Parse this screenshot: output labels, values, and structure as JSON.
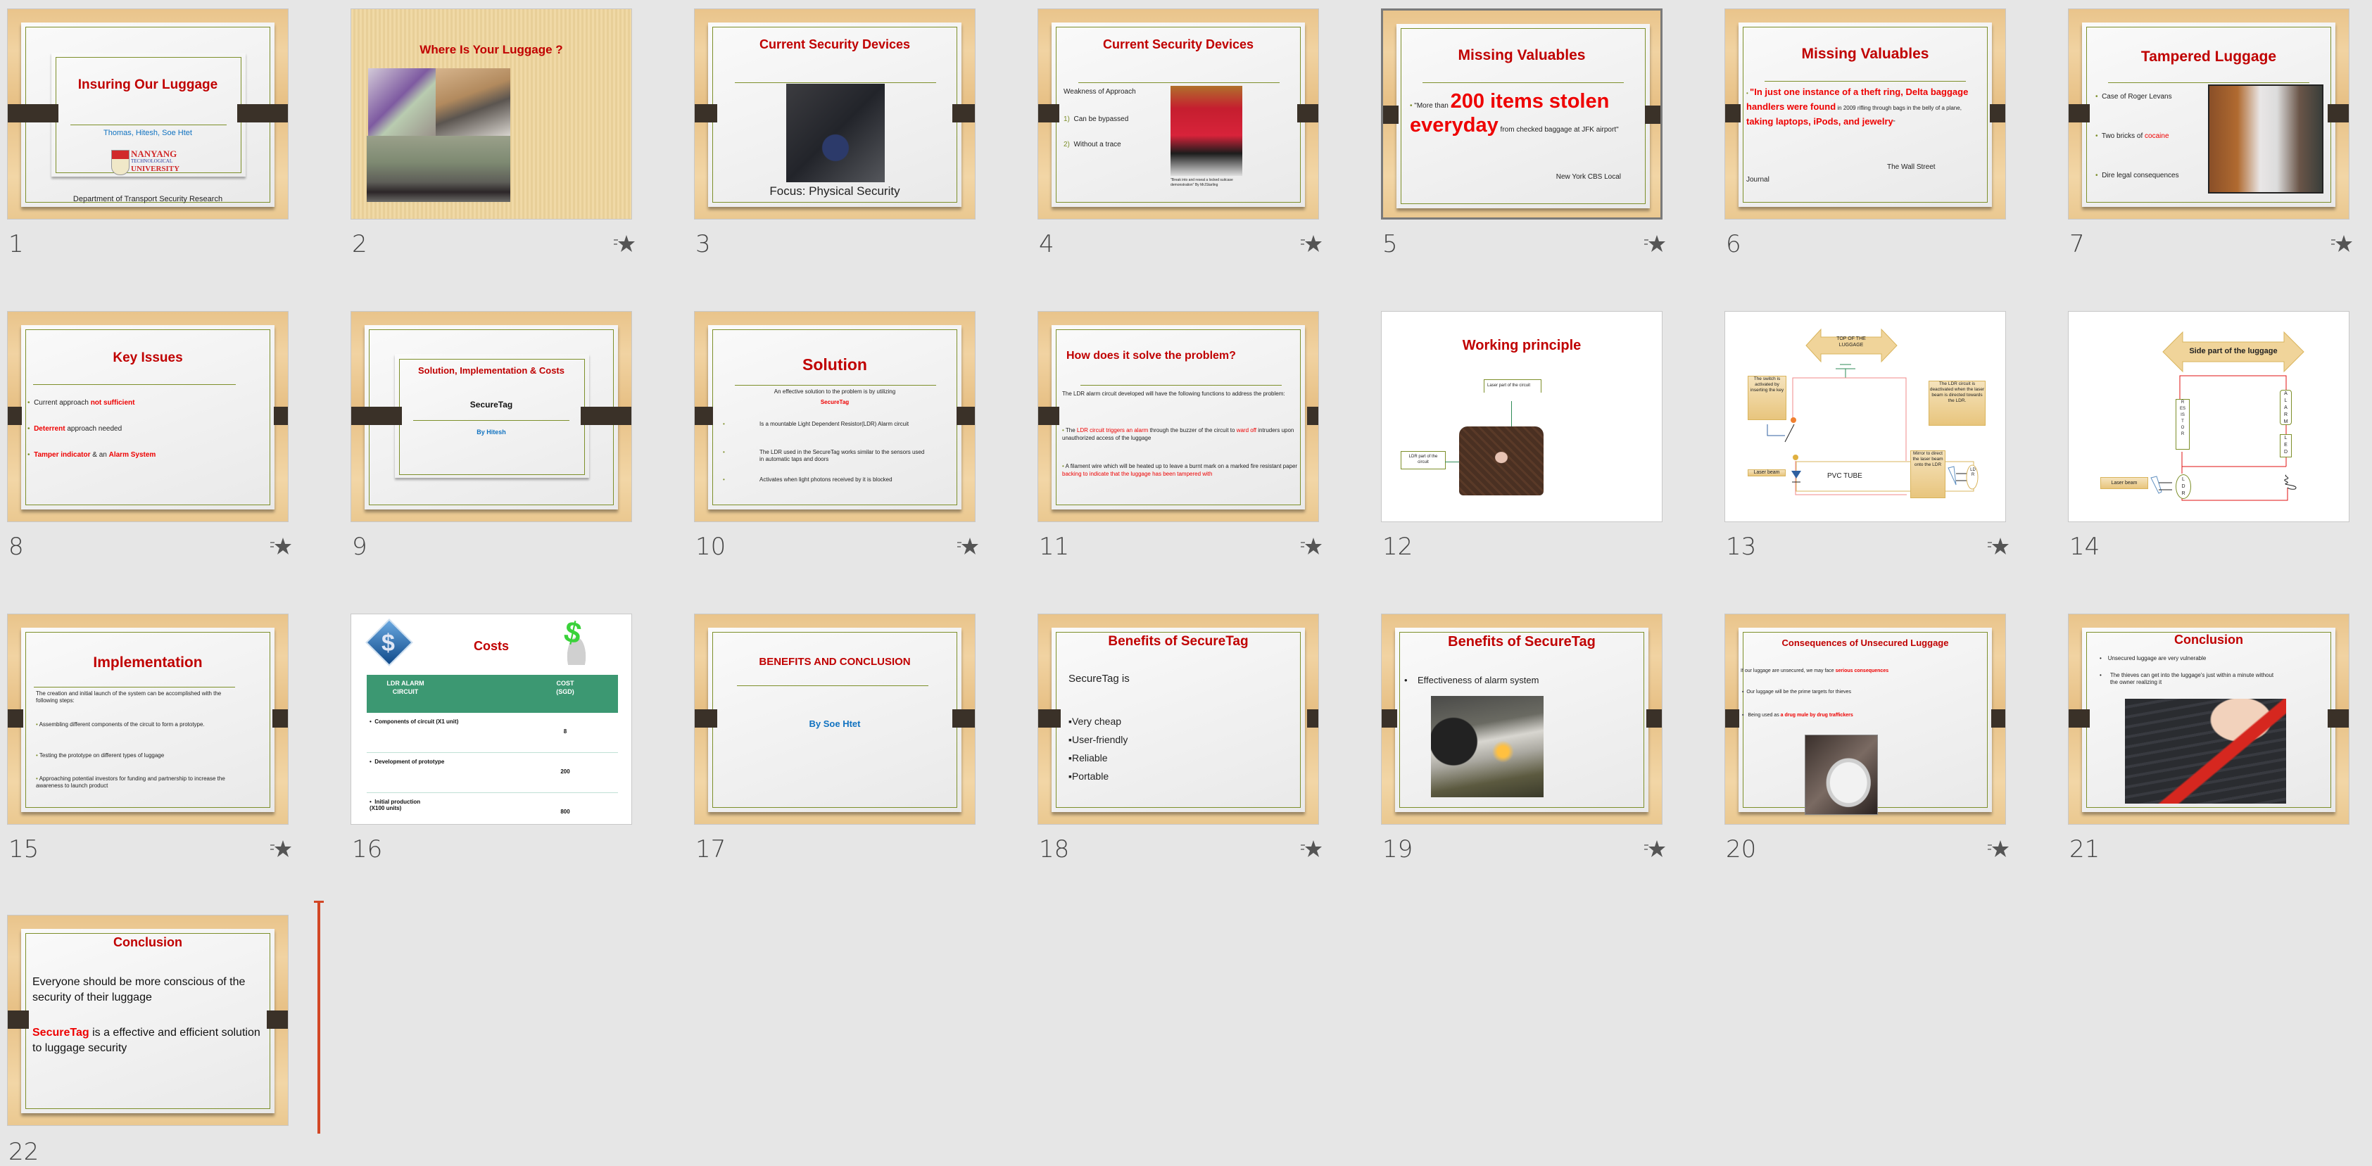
{
  "view": "Slide Sorter",
  "selected_slide": 5,
  "colors": {
    "title_red": "#c00000",
    "accent_red": "#e00000",
    "blue": "#1072c0",
    "olive_rule": "#7d8f2a",
    "insert_cursor": "#d24726",
    "background": "#e6e6e6"
  },
  "slides": [
    {
      "number": "1",
      "has_animation": false,
      "title": "Insuring Our Luggage",
      "authors": "Thomas, Hitesh, Soe Htet",
      "logo": {
        "line1": "NANYANG",
        "line2": "TECHNOLOGICAL",
        "line3": "UNIVERSITY"
      },
      "footer": "Department of Transport Security Research"
    },
    {
      "number": "2",
      "has_animation": true,
      "title": "Where Is Your Luggage ?"
    },
    {
      "number": "3",
      "has_animation": false,
      "title": "Current Security Devices",
      "caption": "Focus: Physical Security"
    },
    {
      "number": "4",
      "has_animation": true,
      "title": "Current Security Devices",
      "intro": "Weakness of Approach",
      "items": [
        "Can be bypassed",
        "Without a trace"
      ],
      "item_markers": [
        "1)",
        "2)"
      ],
      "credit": "\"Break into and reseal a locked suitcase demonstration\" By MrJStarling"
    },
    {
      "number": "5",
      "has_animation": true,
      "title": "Missing Valuables",
      "quote_pre": "\"More than ",
      "quote_big": "200 items stolen everyday",
      "quote_mid": " from checked baggage at JFK airport\"",
      "source": "New York CBS Local"
    },
    {
      "number": "6",
      "has_animation": false,
      "title": "Missing Valuables",
      "q1": "\"In just one instance of a theft ring, Delta baggage handlers were found",
      "q2": " in 2009 rifling through bags in the belly of a plane, ",
      "q3": "taking laptops, iPods, and jewelry",
      "q4": "\"",
      "source1": "The Wall Street",
      "source2": "Journal"
    },
    {
      "number": "7",
      "has_animation": true,
      "title": "Tampered Luggage",
      "b1": "Case of Roger Levans",
      "b2_pre": "Two bricks of ",
      "b2_red": "cocaine",
      "b3": "Dire legal consequences"
    },
    {
      "number": "8",
      "has_animation": true,
      "title": "Key Issues",
      "b1_pre": "Current approach ",
      "b1_red": "not sufficient",
      "b2_red": "Deterrent",
      "b2_post": " approach needed",
      "b3_red1": "Tamper indicator",
      "b3_mid": " & an ",
      "b3_red2": "Alarm System"
    },
    {
      "number": "9",
      "has_animation": false,
      "title": "Solution, Implementation & Costs",
      "subtitle": "SecureTag",
      "by": "By Hitesh"
    },
    {
      "number": "10",
      "has_animation": true,
      "title": "Solution",
      "intro": "An effective solution to the problem is by utilizing",
      "highlight": "SecureTag",
      "bullets": [
        "Is a mountable Light Dependent Resistor(LDR) Alarm circuit",
        "The LDR used in the SecureTag works similar to the sensors used in automatic taps and doors",
        "Activates when light photons received by it is blocked"
      ]
    },
    {
      "number": "11",
      "has_animation": true,
      "title": "How does it solve the problem?",
      "intro": "The LDR alarm circuit developed will have the following functions to address the problem:",
      "b1a": "The ",
      "b1b": "LDR circuit triggers an alarm",
      "b1c": " through the buzzer of the circuit to ",
      "b1d": "ward off",
      "b1e": " intruders upon unauthorized access of the luggage",
      "b2a": "A filament wire which will be heated up to leave a burnt mark on a marked fire resistant paper ",
      "b2b": "backing to indicate that the luggage has been tampered with"
    },
    {
      "number": "12",
      "has_animation": false,
      "title": "Working principle",
      "label_top": "Laser part of the circuit",
      "label_left": "LDR part of the circuit"
    },
    {
      "number": "13",
      "has_animation": true,
      "arrow_label": "TOP OF THE LUGGAGE",
      "switch_note": "The switch is activated by inserting the key",
      "ldr_note": "The LDR circuit is deactivated when the  laser beam is directed towards the LDR.",
      "laser_label": "Laser beam",
      "tube_label": "PVC TUBE",
      "mirror_note": "Mirror to direct the laser beam onto the LDR",
      "ldr_label": "LDR"
    },
    {
      "number": "14",
      "has_animation": false,
      "arrow_label": "Side part of the luggage",
      "resistor": "RESISTOR",
      "alarm": "ALARM",
      "led": "LED",
      "ldr": "LDR",
      "laser_label": "Laser beam"
    },
    {
      "number": "15",
      "has_animation": true,
      "title": "Implementation",
      "intro": "The creation and initial launch of the system can be accomplished with the following steps:",
      "bullets": [
        "Assembling different components of the circuit to form a prototype.",
        "Testing the prototype on different types of luggage",
        "Approaching potential investors for funding and partnership to increase the awareness to launch product"
      ]
    },
    {
      "number": "16",
      "has_animation": false,
      "title": "Costs",
      "table": {
        "headers": [
          "LDR ALARM CIRCUIT",
          "COST (SGD)"
        ],
        "rows": [
          [
            "Components of circuit (X1 unit)",
            "8"
          ],
          [
            "Development of prototype",
            "200"
          ],
          [
            "Initial production (X100 units)",
            "800"
          ]
        ]
      }
    },
    {
      "number": "17",
      "has_animation": false,
      "title": "BENEFITS AND CONCLUSION",
      "by": "By Soe Htet"
    },
    {
      "number": "18",
      "has_animation": true,
      "title": "Benefits of SecureTag",
      "intro": "SecureTag is",
      "bullets": [
        "Very cheap",
        "User-friendly",
        "Reliable",
        "Portable"
      ]
    },
    {
      "number": "19",
      "has_animation": true,
      "title": "Benefits of SecureTag",
      "bullet": "Effectiveness of alarm system"
    },
    {
      "number": "20",
      "has_animation": true,
      "title": "Consequences of Unsecured Luggage",
      "intro_pre": "If our luggage are unsecured, we may face ",
      "intro_red": "serious consequences",
      "b1": "Our luggage will be the prime targets for thieves",
      "b2_pre": "Being used as ",
      "b2_red": "a drug mule by drug traffickers"
    },
    {
      "number": "21",
      "has_animation": false,
      "title": "Conclusion",
      "bullets": [
        "Unsecured luggage are very vulnerable",
        "The thieves can get into the luggage's just within a minute without the owner realizing it"
      ]
    },
    {
      "number": "22",
      "has_animation": false,
      "title": "Conclusion",
      "p1": "Everyone should be more conscious of the security of their luggage",
      "p2_red": "SecureTag",
      "p2_post": " is a effective and efficient solution to luggage security"
    }
  ]
}
